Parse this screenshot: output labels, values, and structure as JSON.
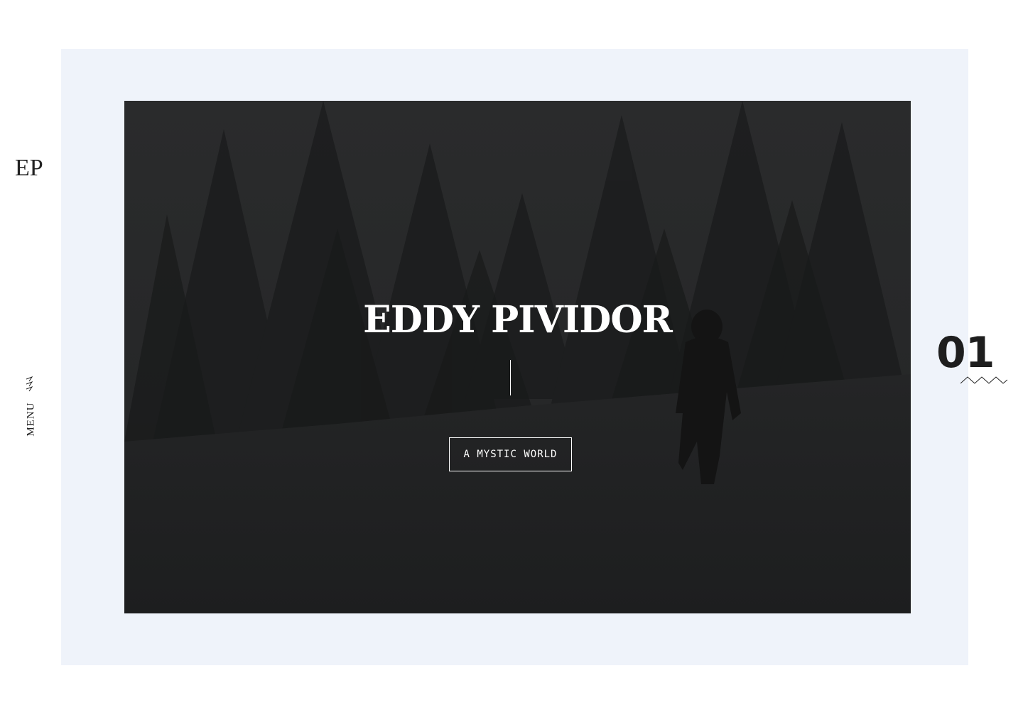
{
  "brand": {
    "logo_text": "EP"
  },
  "nav": {
    "menu_label": "MENU"
  },
  "hero": {
    "title": "EDDY PIVIDOR",
    "button_label": "A MYSTIC WORLD"
  },
  "slider": {
    "current_index": "01"
  },
  "colors": {
    "page_bg": "#ffffff",
    "frame_bg": "#eff3fa",
    "hero_bg": "#1f2021",
    "text_dark": "#1e1e1e",
    "text_light": "#ffffff"
  },
  "icons": {
    "menu": "zigzag-icon",
    "slide_indicator": "wave-line-icon"
  }
}
